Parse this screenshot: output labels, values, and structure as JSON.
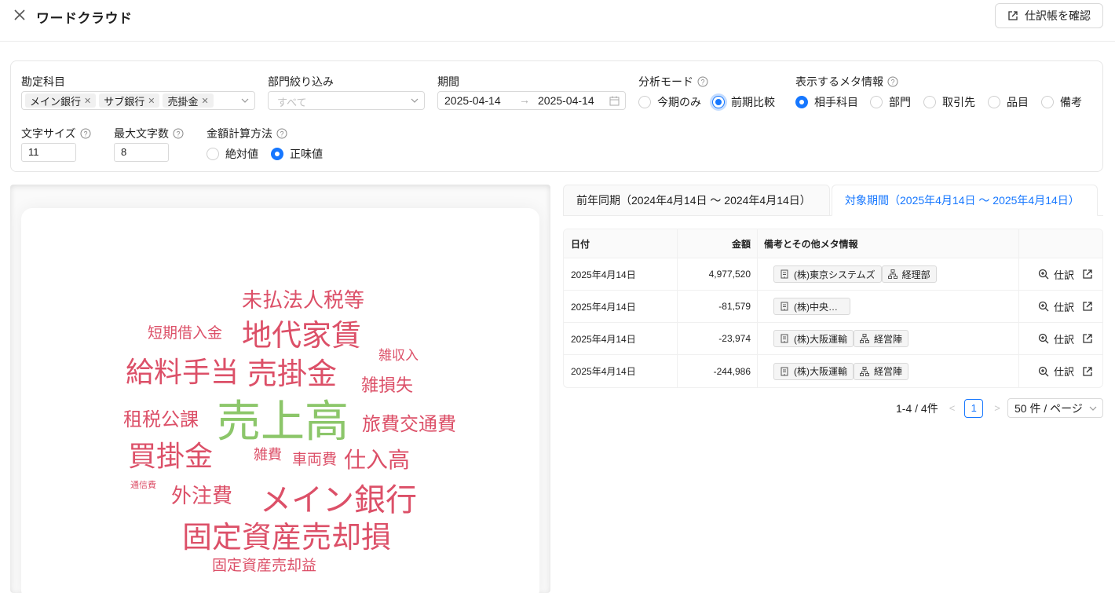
{
  "header": {
    "title": "ワードクラウド",
    "ledger_button": "仕訳帳を確認"
  },
  "filters": {
    "account": {
      "label": "勘定科目",
      "tags": [
        "メイン銀行",
        "サブ銀行",
        "売掛金"
      ]
    },
    "department": {
      "label": "部門絞り込み",
      "placeholder": "すべて"
    },
    "period": {
      "label": "期間",
      "start": "2025-04-14",
      "end": "2025-04-14"
    },
    "analysis_mode": {
      "label": "分析モード",
      "options": [
        "今期のみ",
        "前期比較"
      ],
      "selected": "前期比較"
    },
    "meta_info": {
      "label": "表示するメタ情報",
      "options": [
        "相手科目",
        "部門",
        "取引先",
        "品目",
        "備考"
      ],
      "selected": "相手科目"
    },
    "font_size": {
      "label": "文字サイズ",
      "value": "11"
    },
    "max_chars": {
      "label": "最大文字数",
      "value": "8"
    },
    "amount_method": {
      "label": "金額計算方法",
      "options": [
        "絶対値",
        "正味値"
      ],
      "selected": "正味値"
    }
  },
  "cloud": {
    "colors": {
      "red": "#dc5068",
      "green": "#8cc66a"
    },
    "words": [
      "未払法人税等",
      "短期借入金",
      "地代家賃",
      "雑収入",
      "給料手当",
      "売掛金",
      "雑損失",
      "租税公課",
      "売上高",
      "旅費交通費",
      "買掛金",
      "雑費",
      "車両費",
      "仕入高",
      "通信費",
      "外注費",
      "メイン銀行",
      "固定資産売却損",
      "固定資産売却益"
    ]
  },
  "tabs": [
    {
      "label": "前年同期（2024年4月14日 〜 2024年4月14日）"
    },
    {
      "label": "対象期間（2025年4月14日 〜 2025年4月14日）"
    }
  ],
  "active_tab": 1,
  "table": {
    "columns": [
      "日付",
      "金額",
      "備考とその他メタ情報",
      ""
    ],
    "rows": [
      {
        "date": "2025年4月14日",
        "amount": "4,977,520",
        "partner": "(株)東京システムズ",
        "dept": "経理部"
      },
      {
        "date": "2025年4月14日",
        "amount": "-81,579",
        "partner": "(株)中央…",
        "dept": ""
      },
      {
        "date": "2025年4月14日",
        "amount": "-23,974",
        "partner": "(株)大阪運輸",
        "dept": "経営陣"
      },
      {
        "date": "2025年4月14日",
        "amount": "-244,986",
        "partner": "(株)大阪運輸",
        "dept": "経営陣"
      }
    ],
    "action_label": "仕訳"
  },
  "pagination": {
    "summary": "1-4 / 4件",
    "current": "1",
    "page_size": "50 件 / ページ"
  },
  "accent_color": "#1677ff"
}
